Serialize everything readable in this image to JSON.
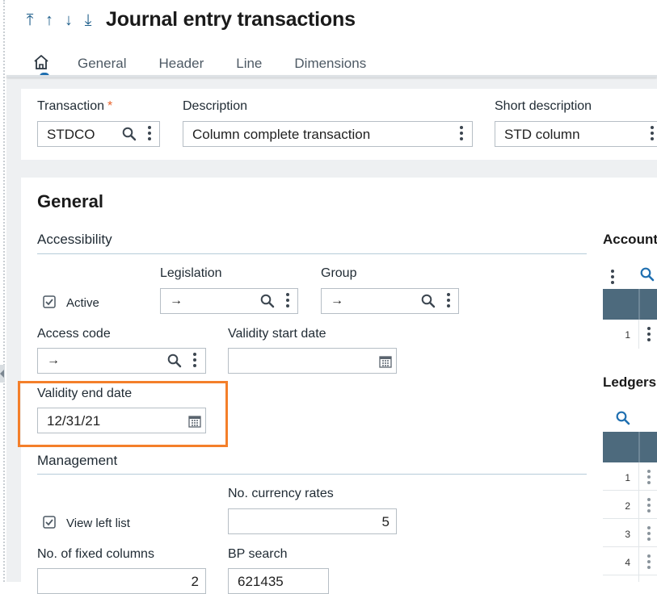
{
  "nav": {
    "arrows": [
      "⤒",
      "↑",
      "↓",
      "⤓"
    ]
  },
  "page": {
    "title": "Journal entry transactions"
  },
  "tabs": [
    {
      "label": "General"
    },
    {
      "label": "Header"
    },
    {
      "label": "Line"
    },
    {
      "label": "Dimensions"
    }
  ],
  "top": {
    "transaction": {
      "label": "Transaction",
      "required_mark": "*",
      "value": "STDCO"
    },
    "description": {
      "label": "Description",
      "value": "Column complete transaction"
    },
    "short_description": {
      "label": "Short description",
      "value": "STD column"
    }
  },
  "general": {
    "title": "General",
    "accessibility": {
      "title": "Accessibility",
      "active": {
        "label": "Active",
        "checked": true
      },
      "legislation": {
        "label": "Legislation",
        "value": "→"
      },
      "group": {
        "label": "Group",
        "value": "→"
      },
      "access_code": {
        "label": "Access code",
        "value": "→"
      },
      "validity_start": {
        "label": "Validity start date",
        "value": ""
      },
      "validity_end": {
        "label": "Validity end date",
        "value": "12/31/21"
      }
    },
    "management": {
      "title": "Management",
      "view_left_list": {
        "label": "View left list",
        "checked": true
      },
      "currency_rates": {
        "label": "No. currency rates",
        "value": "5"
      },
      "fixed_columns": {
        "label": "No. of fixed columns",
        "value": "2"
      },
      "bp_search": {
        "label": "BP search",
        "value": "621435"
      }
    }
  },
  "right": {
    "account": {
      "title": "Account",
      "rows": [
        "1"
      ]
    },
    "ledgers": {
      "title": "Ledgers",
      "rows": [
        "1",
        "2",
        "3",
        "4"
      ]
    }
  },
  "colors": {
    "accent": "#1f6fb0",
    "highlight": "#f47f2a",
    "grid_header": "#4d6a7d"
  }
}
